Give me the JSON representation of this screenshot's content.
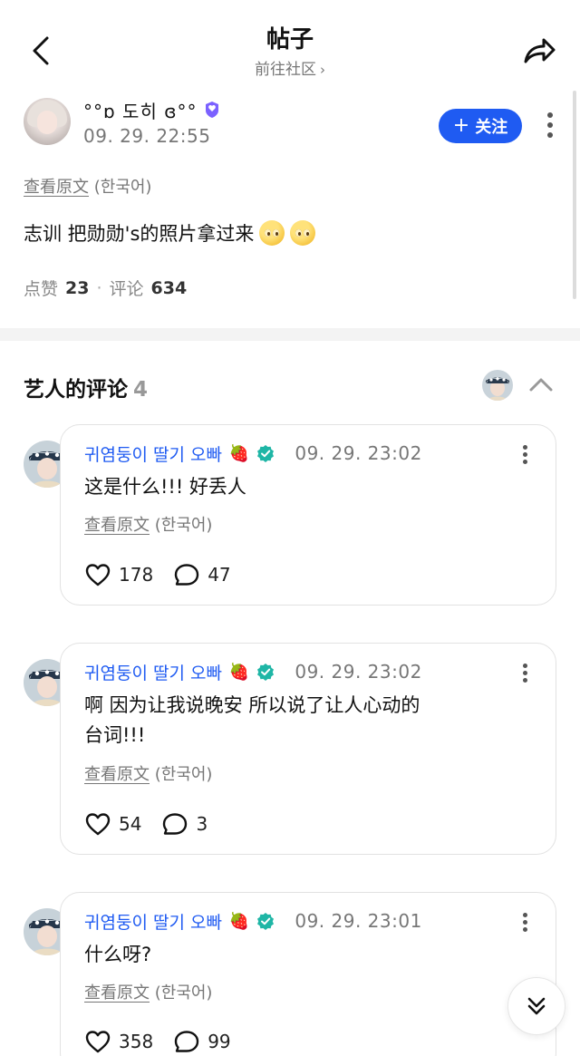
{
  "header": {
    "title": "帖子",
    "subtitle": "前往社区",
    "subtitle_chevron": "›"
  },
  "post": {
    "username": "°°ɒ 도히 ɞ°°",
    "time": "09. 29. 22:55",
    "follow_plus": "+",
    "follow_label": "关注",
    "translate_link": "查看原文",
    "translate_lang": "(한국어)",
    "text": "志训 把勋勋's的照片拿过来",
    "likes_label": "点赞",
    "likes_count": "23",
    "stats_sep": "·",
    "comments_label": "评论",
    "comments_count": "634"
  },
  "artist_comments": {
    "title": "艺人的评论",
    "count": "4",
    "items": [
      {
        "name": "귀염둥이 딸기 오빠",
        "strawberry": "🍓",
        "time": "09. 29. 23:02",
        "lines": [
          "这是什么!!! 好丢人"
        ],
        "translate_link": "查看原文",
        "translate_lang": "(한국어)",
        "likes": "178",
        "replies": "47"
      },
      {
        "name": "귀염둥이 딸기 오빠",
        "strawberry": "🍓",
        "time": "09. 29. 23:02",
        "lines": [
          "啊 因为让我说晚安 所以说了让人心动的",
          "台词!!!"
        ],
        "translate_link": "查看原文",
        "translate_lang": "(한국어)",
        "likes": "54",
        "replies": "3"
      },
      {
        "name": "귀염둥이 딸기 오빠",
        "strawberry": "🍓",
        "time": "09. 29. 23:01",
        "lines": [
          "什么呀?"
        ],
        "translate_link": "查看原文",
        "translate_lang": "(한국어)",
        "likes": "358",
        "replies": "99"
      }
    ]
  },
  "colors": {
    "accent_blue": "#1f5bf2",
    "verified_teal": "#1fb6a6",
    "badge_purple": "#7b61ff"
  }
}
